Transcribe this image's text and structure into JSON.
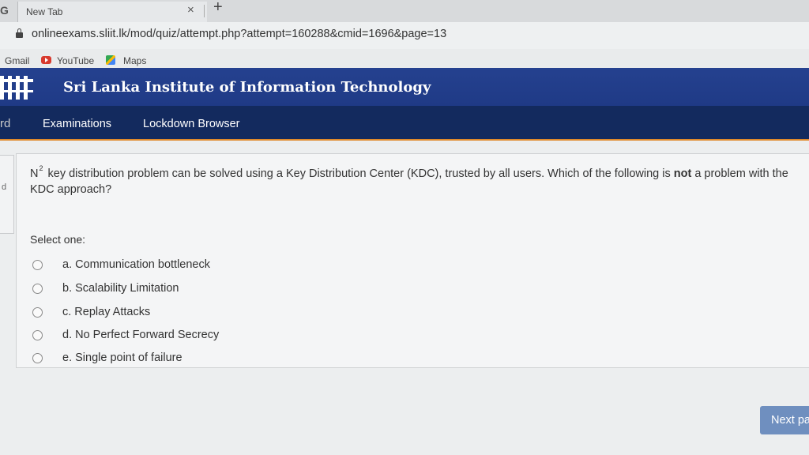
{
  "browser": {
    "tab_favicon": "G",
    "tab_title": "New Tab",
    "tab_close": "×",
    "new_tab": "+",
    "url": "onlineexams.sliit.lk/mod/quiz/attempt.php?attempt=160288&cmid=1696&page=13"
  },
  "bookmarks": [
    {
      "label": "Gmail"
    },
    {
      "label": "YouTube",
      "icon": "youtube-icon"
    },
    {
      "label": "Maps",
      "icon": "maps-icon"
    }
  ],
  "site": {
    "title": "Sri Lanka Institute of Information Technology",
    "brand_color": "#25418f",
    "nav_color": "#132a5e",
    "accent_color": "#e08a2c"
  },
  "nav": {
    "edge_text": "rd",
    "items": [
      {
        "label": "Examinations"
      },
      {
        "label": "Lockdown Browser"
      }
    ]
  },
  "question": {
    "info_text": "d",
    "prefix": "N",
    "superscript": "2",
    "text_part1": " key distribution problem can be solved using a Key Distribution Center (KDC), trusted by all users. Which of the following is ",
    "text_bold": "not",
    "text_part2": " a problem with the KDC approach?",
    "select_label": "Select one:",
    "options": [
      {
        "label": "a. Communication bottleneck",
        "selected": false
      },
      {
        "label": "b. Scalability Limitation",
        "selected": false
      },
      {
        "label": "c. Replay Attacks",
        "selected": false
      },
      {
        "label": "d. No Perfect Forward Secrecy",
        "selected": false
      },
      {
        "label": "e. Single point of failure",
        "selected": false
      }
    ]
  },
  "footer": {
    "next_label": "Next page"
  }
}
